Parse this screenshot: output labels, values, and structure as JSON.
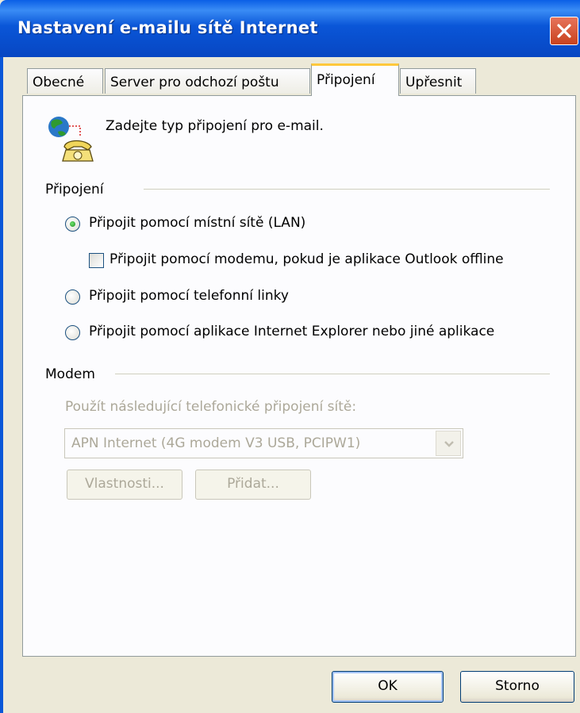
{
  "window": {
    "title": "Nastavení e-mailu sítě Internet"
  },
  "tabs": [
    {
      "label": "Obecné"
    },
    {
      "label": "Server pro odchozí poštu"
    },
    {
      "label": "Připojení"
    },
    {
      "label": "Upřesnit"
    }
  ],
  "intro": {
    "text": "Zadejte typ připojení pro e-mail.",
    "icon": "globe-phone-icon"
  },
  "connection": {
    "group_label": "Připojení",
    "option_lan": {
      "label": "Připojit pomocí místní sítě (LAN)",
      "selected": true
    },
    "option_modem_offline": {
      "label": "Připojit pomocí modemu, pokud je aplikace Outlook offline",
      "checked": false
    },
    "option_phone": {
      "label": "Připojit pomocí telefonní linky",
      "selected": false
    },
    "option_ie": {
      "label": "Připojit pomocí aplikace Internet Explorer nebo jiné aplikace",
      "selected": false
    }
  },
  "modem": {
    "group_label": "Modem",
    "dialup_label": "Použít následující telefonické připojení sítě:",
    "dialup_value": "APN Internet (4G modem V3 USB, PCIPW1)",
    "properties_label": "Vlastnosti...",
    "add_label": "Přidat..."
  },
  "buttons": {
    "ok_label": "OK",
    "cancel_label": "Storno"
  }
}
